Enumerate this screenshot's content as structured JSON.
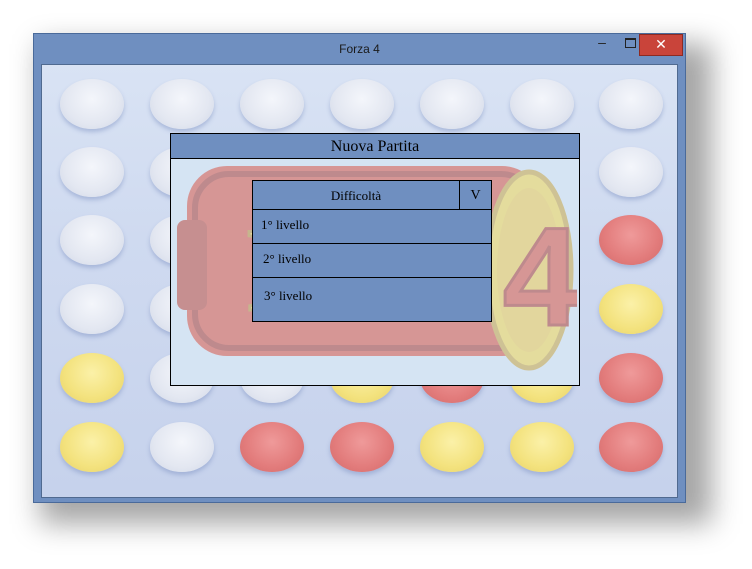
{
  "window": {
    "title": "Forza 4",
    "minimize_glyph": "–",
    "close_glyph": "✕"
  },
  "board": {
    "rows": [
      [
        "empty",
        "empty",
        "empty",
        "empty",
        "empty",
        "empty",
        "empty"
      ],
      [
        "empty",
        "empty",
        "empty",
        "empty",
        "empty",
        "empty",
        "empty"
      ],
      [
        "empty",
        "empty",
        "empty",
        "empty",
        "empty",
        "empty",
        "red"
      ],
      [
        "empty",
        "empty",
        "empty",
        "empty",
        "empty",
        "empty",
        "yellow"
      ],
      [
        "yellow",
        "empty",
        "empty",
        "yellow",
        "red",
        "yellow",
        "red"
      ],
      [
        "yellow",
        "empty",
        "red",
        "red",
        "yellow",
        "yellow",
        "red"
      ]
    ],
    "colors": {
      "red": "#e27b7b",
      "yellow": "#f3e27d",
      "empty": "#e3e7f1"
    }
  },
  "dialog": {
    "title": "Nuova Partita",
    "logo_text": "Forza 4",
    "dropdown": {
      "label": "Difficoltà",
      "arrow": "V",
      "options": [
        "1° livello",
        "2° livello",
        "3° livello"
      ]
    }
  },
  "colors": {
    "frame": "#6f8fc0",
    "close": "#c9443a",
    "dialog_bg": "#d5e4f3"
  }
}
